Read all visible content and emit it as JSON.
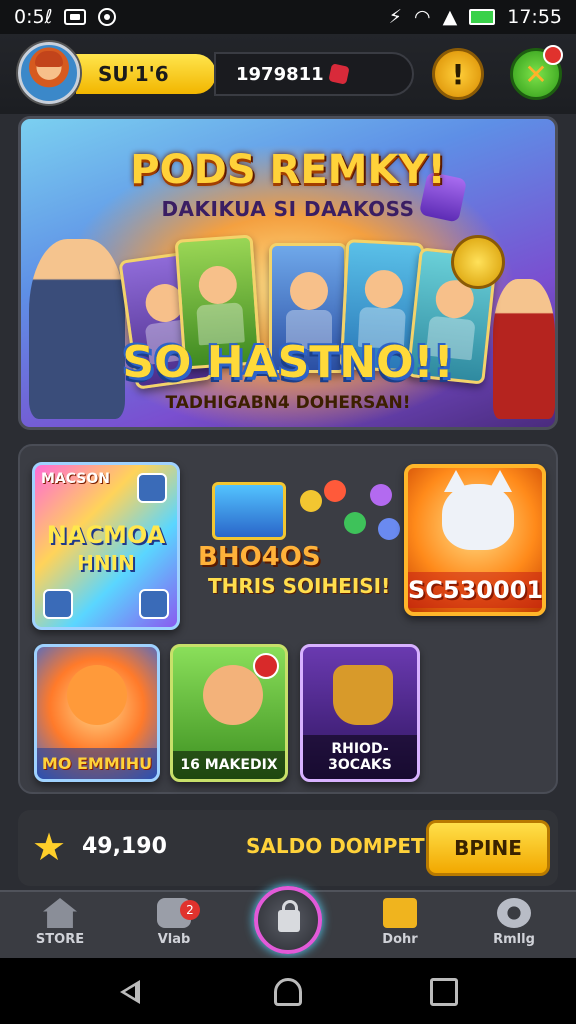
{
  "status_bar": {
    "time_left": "0:5ℓ",
    "time_right": "17:55"
  },
  "header": {
    "player_name": "SU'1'6",
    "coins": "1979811",
    "alert_symbol": "!",
    "close_symbol": "✕"
  },
  "hero": {
    "title": "PODS REMKY!",
    "subtitle": "DAKIKUA SI DAAKOSS",
    "big_text": "SO HASTNO!!",
    "tagline": "TADHIGABN4 DOHERSAN!"
  },
  "games": {
    "tile_1": {
      "corner": "MACSON",
      "line1": "NACMOA",
      "line2": "HNIN"
    },
    "promo": {
      "title": "BHO4OS",
      "subtitle": "THRIS SOIHEISI!"
    },
    "tile_3": {
      "amount": "SC530001"
    },
    "tile_4": {
      "label": "MO EMMIHU"
    },
    "tile_5": {
      "label": "16 MAKEDIX"
    },
    "tile_6": {
      "label": "RHIOD-3OCAKS"
    }
  },
  "wallet": {
    "amount": "49,190",
    "label": "SALDO DOMPET",
    "button": "BPINE"
  },
  "bottom_nav": {
    "items": [
      {
        "label": "STORE"
      },
      {
        "label": "Vlab",
        "badge": "2"
      },
      {
        "label": ""
      },
      {
        "label": "Dohr"
      },
      {
        "label": "Rmllg"
      }
    ]
  },
  "colors": {
    "accent_yellow": "#ffd23a",
    "background": "#2b2d33",
    "badge_red": "#e0322d"
  }
}
